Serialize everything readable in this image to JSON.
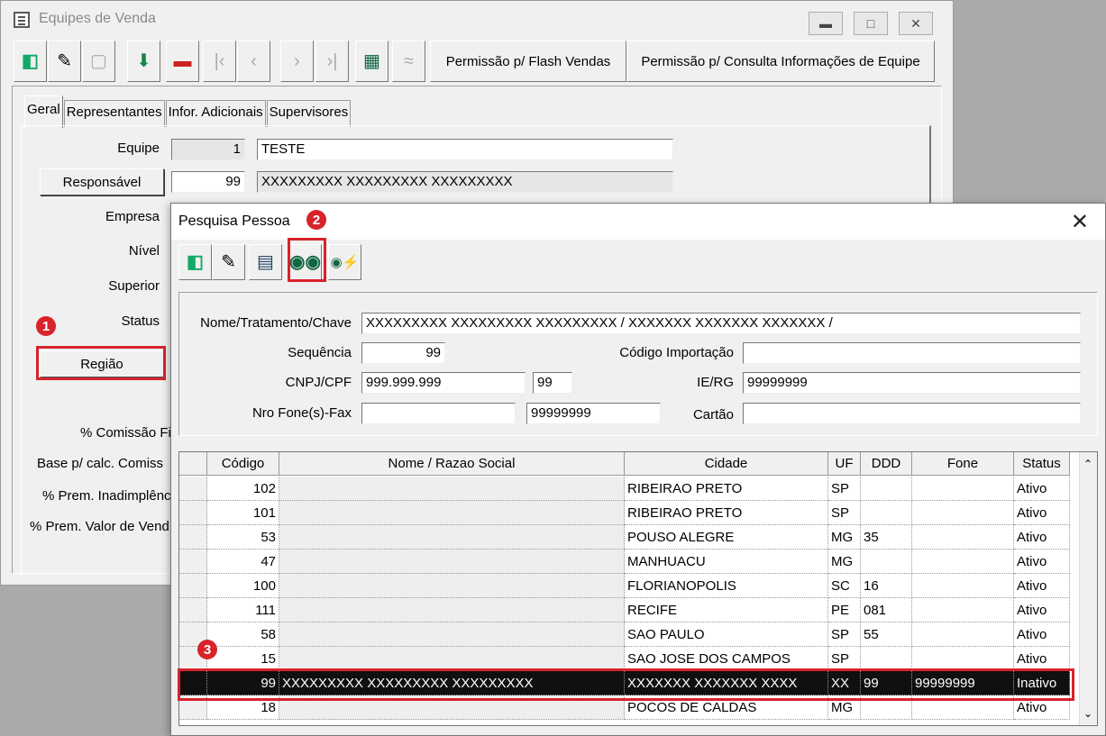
{
  "back_window": {
    "title": "Equipes de Venda",
    "toolbar": {
      "flash_btn": "Permissão p/ Flash Vendas",
      "consulta_btn": "Permissão p/ Consulta Informações de Equipe"
    },
    "tabs": [
      "Geral",
      "Representantes",
      "Infor. Adicionais",
      "Supervisores"
    ],
    "form": {
      "equipe_label": "Equipe",
      "equipe_code": "1",
      "equipe_name": "TESTE",
      "responsavel_btn": "Responsável",
      "responsavel_code": "99",
      "responsavel_name": "XXXXXXXXX XXXXXXXXX XXXXXXXXX",
      "empresa_label": "Empresa",
      "nivel_label": "Nível",
      "superior_label": "Superior",
      "status_label": "Status",
      "regiao_btn": "Região",
      "comissao_label": "% Comissão Fi",
      "base_label": "Base p/ calc. Comiss",
      "prem_inad_label": "% Prem. Inadimplênc",
      "prem_valor_label": "% Prem. Valor de Vend"
    }
  },
  "dialog": {
    "title": "Pesquisa Pessoa",
    "fields": {
      "nome_label": "Nome/Tratamento/Chave",
      "nome_value": "XXXXXXXXX XXXXXXXXX XXXXXXXXX / XXXXXXX XXXXXXX XXXXXXX /",
      "sequencia_label": "Sequência",
      "sequencia_value": "99",
      "cod_import_label": "Código Importação",
      "cod_import_value": "",
      "cnpj_label": "CNPJ/CPF",
      "cnpj_value": "999.999.999",
      "cnpj_dv": "99",
      "ie_label": "IE/RG",
      "ie_value": "99999999",
      "fone_label": "Nro Fone(s)-Fax",
      "fone_value1": "",
      "fone_value2": "99999999",
      "cartao_label": "Cartão",
      "cartao_value": ""
    },
    "grid": {
      "headers": [
        "Código",
        "Nome / Razao Social",
        "Cidade",
        "UF",
        "DDD",
        "Fone",
        "Status"
      ],
      "rows": [
        [
          "102",
          "",
          "RIBEIRAO PRETO",
          "SP",
          "",
          "",
          "Ativo"
        ],
        [
          "101",
          "",
          "RIBEIRAO PRETO",
          "SP",
          "",
          "",
          "Ativo"
        ],
        [
          "53",
          "",
          "POUSO ALEGRE",
          "MG",
          "35",
          "",
          "Ativo"
        ],
        [
          "47",
          "",
          "MANHUACU",
          "MG",
          "",
          "",
          "Ativo"
        ],
        [
          "100",
          "",
          "FLORIANOPOLIS",
          "SC",
          "16",
          "",
          "Ativo"
        ],
        [
          "111",
          "",
          "RECIFE",
          "PE",
          "081",
          "",
          "Ativo"
        ],
        [
          "58",
          "",
          "SAO PAULO",
          "SP",
          "55",
          "",
          "Ativo"
        ],
        [
          "15",
          "",
          "SAO JOSE DOS CAMPOS",
          "SP",
          "",
          "",
          "Ativo"
        ],
        [
          "99",
          "XXXXXXXXX XXXXXXXXX XXXXXXXXX",
          "XXXXXXX XXXXXXX XXXX",
          "XX",
          "99",
          "99999999",
          "Inativo"
        ],
        [
          "18",
          "",
          "POCOS DE CALDAS",
          "MG",
          "",
          "",
          "Ativo"
        ]
      ],
      "selected_index": 8
    }
  },
  "annotations": {
    "badge1": "1",
    "badge2": "2",
    "badge3": "3",
    "accent": "#d8232a"
  }
}
